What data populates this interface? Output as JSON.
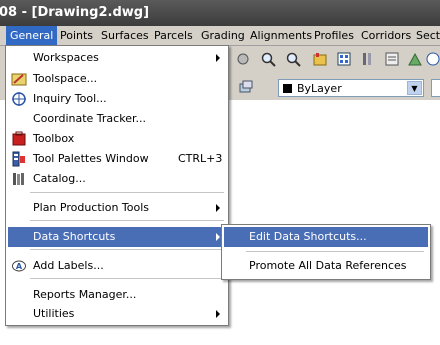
{
  "title": {
    "text": "08 - [Drawing2.dwg]"
  },
  "menubar": {
    "items": [
      {
        "label": "General",
        "active": true
      },
      {
        "label": "Points"
      },
      {
        "label": "Surfaces"
      },
      {
        "label": "Parcels"
      },
      {
        "label": "Grading"
      },
      {
        "label": "Alignments"
      },
      {
        "label": "Profiles"
      },
      {
        "label": "Corridors"
      },
      {
        "label": "Secti"
      }
    ]
  },
  "toolbar": {
    "layer_combo": {
      "value": "ByLayer",
      "swatch_color": "#000000"
    }
  },
  "general_menu": {
    "items": [
      {
        "label": "Workspaces",
        "mnemonic": "W",
        "submenu": true,
        "icon": "none"
      },
      {
        "label": "Toolspace...",
        "icon": "toolspace-icon"
      },
      {
        "label": "Inquiry Tool...",
        "icon": "inquiry-icon"
      },
      {
        "label": "Coordinate Tracker...",
        "icon": "none"
      },
      {
        "label": "Toolbox",
        "icon": "toolbox-icon"
      },
      {
        "label": "Tool Palettes Window",
        "shortcut": "CTRL+3",
        "icon": "tool-palettes-icon"
      },
      {
        "label": "Catalog...",
        "icon": "catalog-icon"
      },
      {
        "label": "Plan Production Tools",
        "submenu": true,
        "icon": "none"
      },
      {
        "label": "Data Shortcuts",
        "submenu": true,
        "highlighted": true,
        "icon": "none"
      },
      {
        "label": "Add Labels...",
        "icon": "add-labels-icon"
      },
      {
        "label": "Reports Manager...",
        "icon": "none"
      },
      {
        "label": "Utilities",
        "submenu": true,
        "icon": "none"
      }
    ]
  },
  "data_shortcuts_menu": {
    "items": [
      {
        "label": "Edit Data Shortcuts...",
        "highlighted": true
      },
      {
        "label": "Promote All Data References"
      }
    ]
  }
}
